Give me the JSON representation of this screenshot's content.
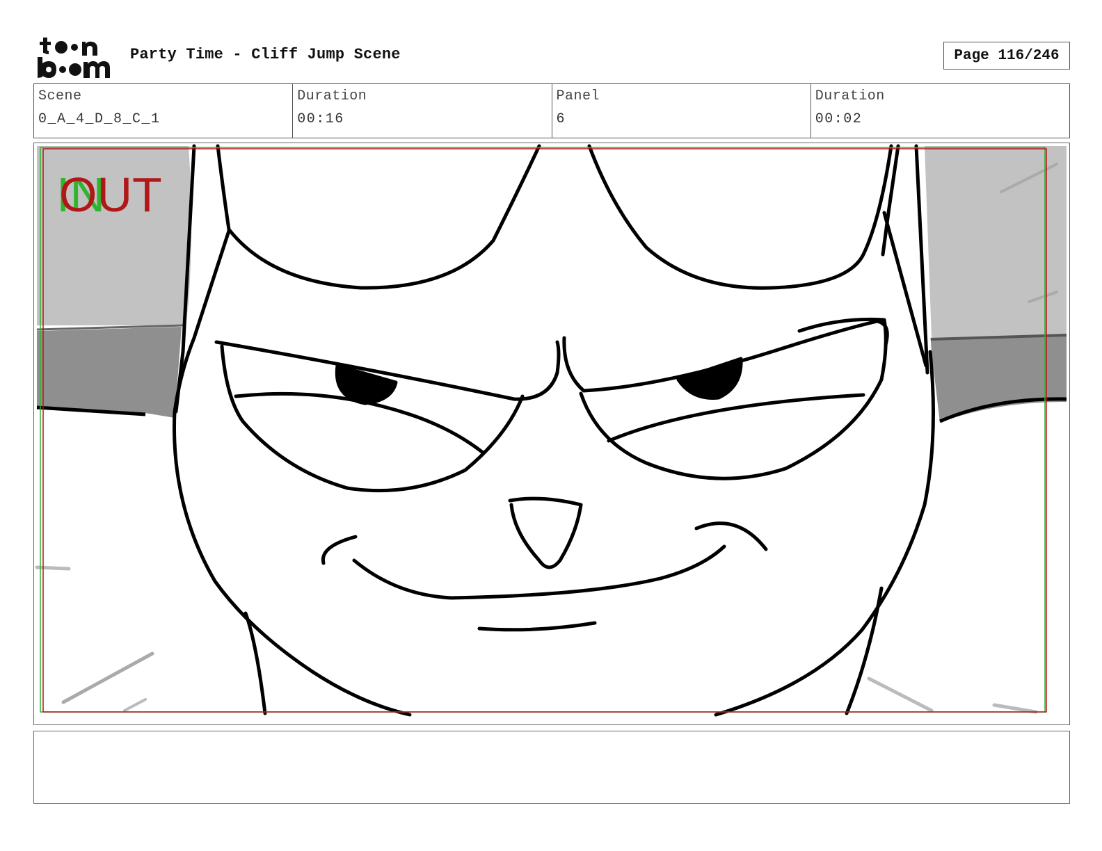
{
  "header": {
    "title": "Party Time - Cliff Jump Scene",
    "page_label": "Page 116/246",
    "logo_icon": "toonboom-logo-icon"
  },
  "info": {
    "scene_label": "Scene",
    "scene_value": "0_A_4_D_8_C_1",
    "scene_duration_label": "Duration",
    "scene_duration_value": "00:16",
    "panel_label": "Panel",
    "panel_value": "6",
    "panel_duration_label": "Duration",
    "panel_duration_value": "00:02"
  },
  "panel": {
    "in_label": "IN",
    "out_label": "OUT",
    "in_color": "#2db52d",
    "out_color": "#b01818"
  },
  "notes": {
    "text": ""
  }
}
